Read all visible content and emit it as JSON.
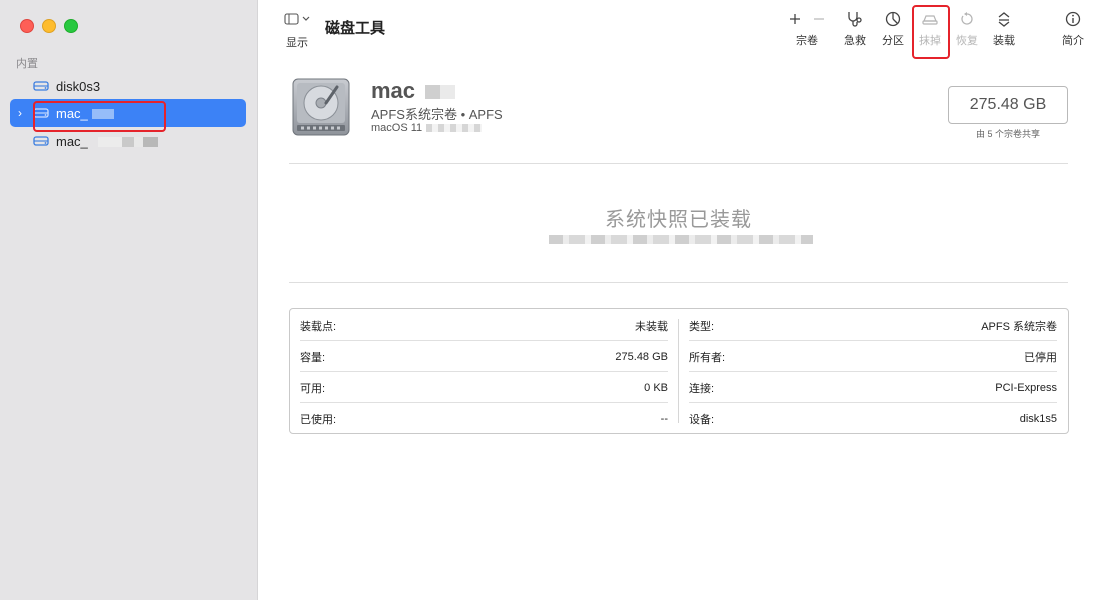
{
  "sidebar": {
    "section_label": "内置",
    "items": [
      {
        "label": "disk0s3",
        "selected": false
      },
      {
        "label": "mac_",
        "selected": true
      },
      {
        "label": "mac_",
        "selected": false
      }
    ]
  },
  "toolbar": {
    "view_label": "显示",
    "title": "磁盘工具",
    "buttons": [
      {
        "label": "宗卷",
        "icon": "plus-minus-icon",
        "disabled": false
      },
      {
        "label": "急救",
        "icon": "stethoscope-icon",
        "disabled": false
      },
      {
        "label": "分区",
        "icon": "partition-icon",
        "disabled": false
      },
      {
        "label": "抹掉",
        "icon": "erase-icon",
        "disabled": true
      },
      {
        "label": "恢复",
        "icon": "restore-icon",
        "disabled": true
      },
      {
        "label": "装载",
        "icon": "mount-icon",
        "disabled": false
      },
      {
        "label": "简介",
        "icon": "info-icon",
        "disabled": false
      }
    ]
  },
  "volume": {
    "name": "mac",
    "type": "APFS系统宗卷 • APFS",
    "os": "macOS 11",
    "size": "275.48 GB",
    "size_note": "由 5 个宗卷共享"
  },
  "snapshot": {
    "title": "系统快照已装载"
  },
  "info": {
    "left": [
      {
        "key": "装载点:",
        "value": "未装载"
      },
      {
        "key": "容量:",
        "value": "275.48 GB"
      },
      {
        "key": "可用:",
        "value": "0 KB"
      },
      {
        "key": "已使用:",
        "value": "--"
      }
    ],
    "right": [
      {
        "key": "类型:",
        "value": "APFS 系统宗卷"
      },
      {
        "key": "所有者:",
        "value": "已停用"
      },
      {
        "key": "连接:",
        "value": "PCI-Express"
      },
      {
        "key": "设备:",
        "value": "disk1s5"
      }
    ]
  },
  "colors": {
    "accent": "#3c82f6",
    "highlight_box": "#e5232b"
  }
}
